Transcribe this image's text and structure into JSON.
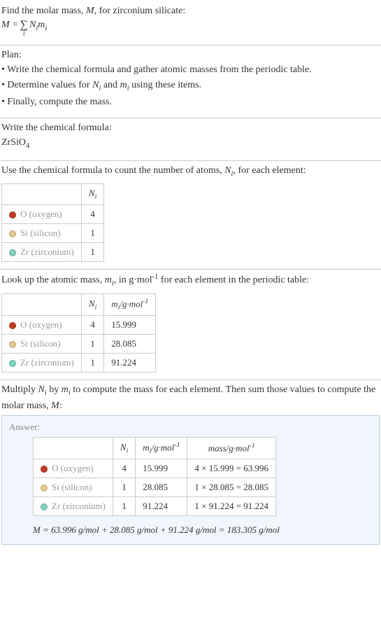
{
  "intro": {
    "line1_prefix": "Find the molar mass, ",
    "line1_m": "M",
    "line1_suffix": ", for zirconium silicate:",
    "formula_lhs": "M = ",
    "formula_sum_index": "i",
    "formula_rhs": " N",
    "formula_rhs_sub": "i",
    "formula_rhs2": "m",
    "formula_rhs2_sub": "i"
  },
  "plan": {
    "heading": "Plan:",
    "b1_pre": "• Write the chemical formula and gather atomic masses from the periodic table.",
    "b2_pre": "• Determine values for ",
    "b2_n": "N",
    "b2_nsub": "i",
    "b2_and": " and ",
    "b2_m": "m",
    "b2_msub": "i",
    "b2_post": " using these items.",
    "b3": "• Finally, compute the mass."
  },
  "step_formula": {
    "text": "Write the chemical formula:",
    "compound_base": "ZrSiO",
    "compound_sub": "4"
  },
  "step_count": {
    "text_pre": "Use the chemical formula to count the number of atoms, ",
    "n": "N",
    "nsub": "i",
    "text_post": ", for each element:",
    "header_n": "N",
    "header_nsub": "i",
    "rows": [
      {
        "color": "#c23b22",
        "label": "O (oxygen)",
        "n": "4"
      },
      {
        "color": "#e6c88c",
        "label": "Si (silicon)",
        "n": "1"
      },
      {
        "color": "#7dd3c0",
        "label": "Zr (zirconium)",
        "n": "1"
      }
    ]
  },
  "step_lookup": {
    "text_pre": "Look up the atomic mass, ",
    "m": "m",
    "msub": "i",
    "text_mid": ", in g·mol",
    "text_sup": "-1",
    "text_post": " for each element in the periodic table:",
    "header_n": "N",
    "header_nsub": "i",
    "header_m": "m",
    "header_msub": "i",
    "header_unit": "/g·mol",
    "header_sup": "-1",
    "rows": [
      {
        "color": "#c23b22",
        "label": "O (oxygen)",
        "n": "4",
        "m": "15.999"
      },
      {
        "color": "#e6c88c",
        "label": "Si (silicon)",
        "n": "1",
        "m": "28.085"
      },
      {
        "color": "#7dd3c0",
        "label": "Zr (zirconium)",
        "n": "1",
        "m": "91.224"
      }
    ]
  },
  "step_multiply": {
    "text_pre": "Multiply ",
    "n": "N",
    "nsub": "i",
    "text_by": " by ",
    "m": "m",
    "msub": "i",
    "text_post": " to compute the mass for each element. Then sum those values to compute the molar mass, ",
    "M": "M",
    "colon": ":"
  },
  "answer": {
    "label": "Answer:",
    "header_n": "N",
    "header_nsub": "i",
    "header_m": "m",
    "header_msub": "i",
    "header_unit": "/g·mol",
    "header_sup": "-1",
    "header_mass": "mass/g·mol",
    "header_mass_sup": "-1",
    "rows": [
      {
        "color": "#c23b22",
        "label": "O (oxygen)",
        "n": "4",
        "m": "15.999",
        "calc": "4 × 15.999 = 63.996"
      },
      {
        "color": "#e6c88c",
        "label": "Si (silicon)",
        "n": "1",
        "m": "28.085",
        "calc": "1 × 28.085 = 28.085"
      },
      {
        "color": "#7dd3c0",
        "label": "Zr (zirconium)",
        "n": "1",
        "m": "91.224",
        "calc": "1 × 91.224 = 91.224"
      }
    ],
    "final": "M = 63.996 g/mol + 28.085 g/mol + 91.224 g/mol = 183.305 g/mol"
  }
}
